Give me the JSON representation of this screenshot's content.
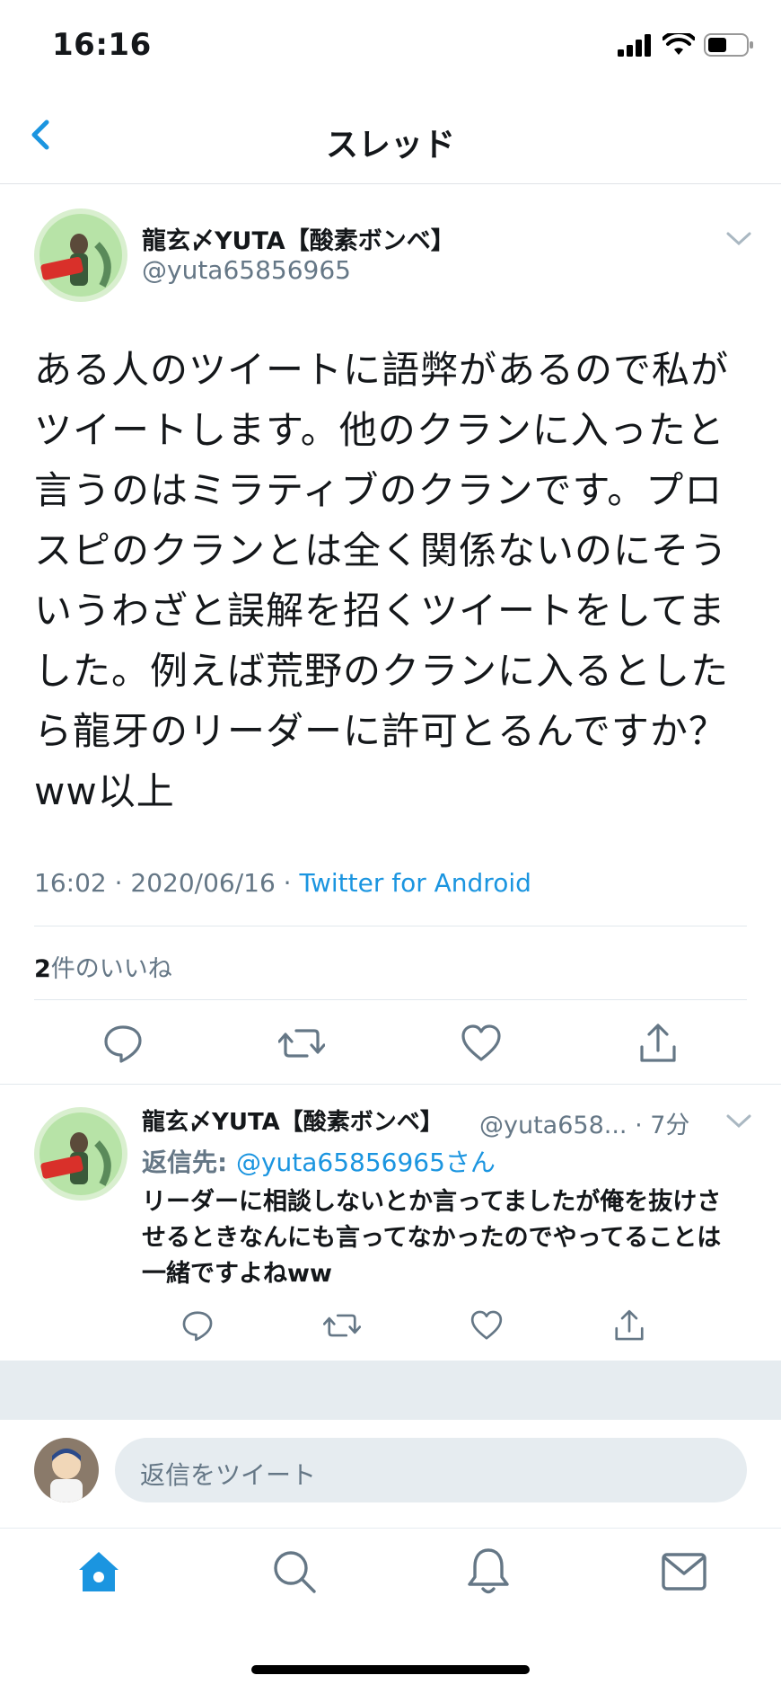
{
  "status_bar": {
    "time": "16:16"
  },
  "nav": {
    "title": "スレッド"
  },
  "tweet": {
    "display_name": "龍玄〆YUTA【酸素ボンベ】",
    "handle": "@yuta65856965",
    "text": "ある人のツイートに語弊があるので私がツイートします。他のクランに入ったと言うのはミラティブのクランです。プロスピのクランとは全く関係ないのにそういうわざと誤解を招くツイートをしてました。例えば荒野のクランに入るとしたら龍牙のリーダーに許可とるんですか？ww以上",
    "time_date": "16:02 · 2020/06/16 · ",
    "source": "Twitter for Android",
    "likes_count": "2",
    "likes_label": "件のいいね"
  },
  "reply": {
    "display_name": "龍玄〆YUTA【酸素ボンベ】",
    "handle_time": "@yuta658... · 7分",
    "reply_to_label": "返信先: ",
    "reply_to_handle": "@yuta65856965さん",
    "text": "リーダーに相談しないとか言ってましたが俺を抜けさせるときなんにも言ってなかったのでやってることは一緒ですよねww"
  },
  "compose": {
    "placeholder": "返信をツイート"
  },
  "colors": {
    "accent": "#1b95e0",
    "secondary_text": "#657786",
    "divider": "#e1e8ed"
  }
}
